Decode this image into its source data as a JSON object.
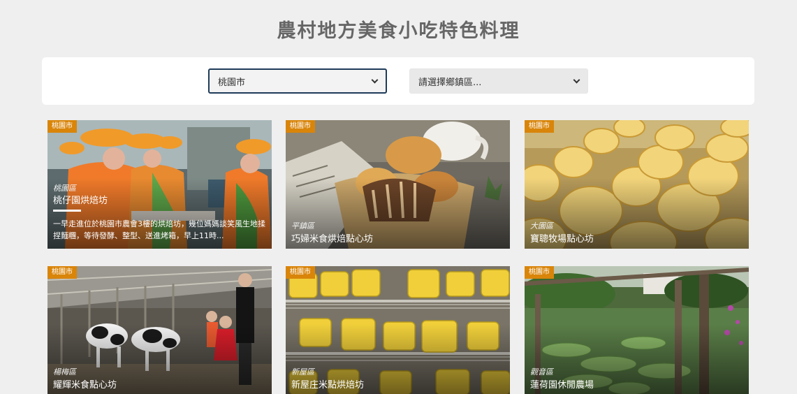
{
  "page": {
    "title": "農村地方美食小吃特色料理"
  },
  "filters": {
    "city_value": "桃園市",
    "town_placeholder": "請選擇鄉鎮區..."
  },
  "cards": [
    {
      "badge": "桃園市",
      "district": "桃園區",
      "name": "桃仔園烘焙坊",
      "desc": "一早走進位於桃園市農會3樓的烘焙坊，幾位媽媽談笑風生地揉捏麵糰，等待發酵、整型、送進烤箱，早上11時..."
    },
    {
      "badge": "桃園市",
      "district": "平鎮區",
      "name": "巧婦米食烘焙點心坊"
    },
    {
      "badge": "桃園市",
      "district": "大園區",
      "name": "寶聰牧場點心坊"
    },
    {
      "badge": "桃園市",
      "district": "楊梅區",
      "name": "耀輝米食點心坊"
    },
    {
      "badge": "桃園市",
      "district": "新屋區",
      "name": "新屋庄米點烘焙坊"
    },
    {
      "badge": "桃園市",
      "district": "觀音區",
      "name": "蓮荷園休閒農場"
    }
  ],
  "colors": {
    "badge": "#d9850a",
    "select_border": "#1f3b5a"
  }
}
